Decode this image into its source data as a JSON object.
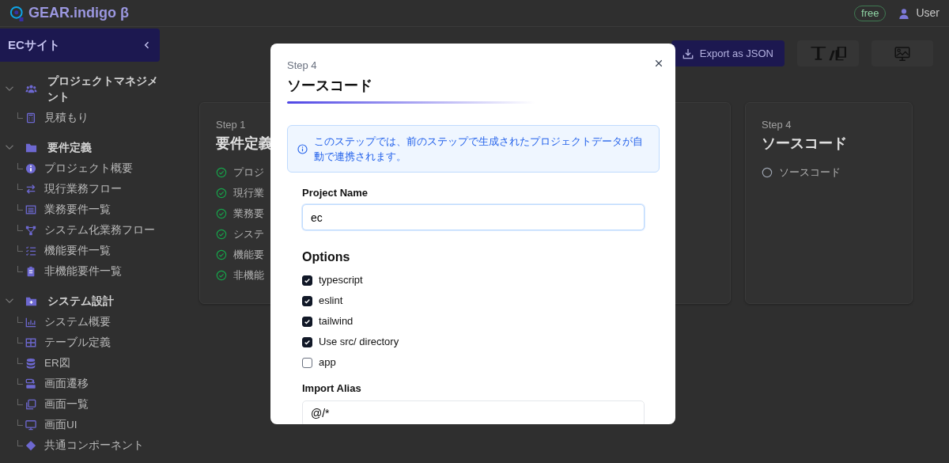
{
  "app_header": {
    "logo": "GEAR.indigo β",
    "plan_badge": "free",
    "user": "User"
  },
  "sidebar": {
    "project": "ECサイト",
    "groups": [
      {
        "label": "プロジェクトマネジメント",
        "expanded": true,
        "items": [
          {
            "label": "見積もり"
          }
        ]
      },
      {
        "label": "要件定義",
        "expanded": true,
        "items": [
          {
            "label": "プロジェクト概要"
          },
          {
            "label": "現行業務フロー"
          },
          {
            "label": "業務要件一覧"
          },
          {
            "label": "システム化業務フロー"
          },
          {
            "label": "機能要件一覧"
          },
          {
            "label": "非機能要件一覧"
          }
        ]
      },
      {
        "label": "システム設計",
        "expanded": true,
        "items": [
          {
            "label": "システム概要"
          },
          {
            "label": "テーブル定義"
          },
          {
            "label": "ER図"
          },
          {
            "label": "画面遷移"
          },
          {
            "label": "画面一覧"
          },
          {
            "label": "画面UI"
          },
          {
            "label": "共通コンポーネント"
          }
        ]
      }
    ]
  },
  "toolbar": {
    "export_button": "Export as JSON"
  },
  "step_cards": [
    {
      "step": "Step 1",
      "title": "要件定義",
      "items": [
        {
          "label": "プロジ",
          "done": true
        },
        {
          "label": "現行業",
          "done": true
        },
        {
          "label": "業務要",
          "done": true
        },
        {
          "label": "システ",
          "done": true
        },
        {
          "label": "機能要",
          "done": true
        },
        {
          "label": "非機能",
          "done": true
        }
      ]
    },
    {
      "step": "Step 4",
      "title": "ソースコード",
      "items": [
        {
          "label": "ソースコード",
          "done": false
        }
      ]
    }
  ],
  "dialog": {
    "step": "Step 4",
    "title": "ソースコード",
    "info": "このステップでは、前のステップで生成されたプロジェクトデータが自動で連携されます。",
    "project_name": {
      "label": "Project Name",
      "value": "ec"
    },
    "options": {
      "title": "Options",
      "items": [
        {
          "label": "typescript",
          "checked": true
        },
        {
          "label": "eslint",
          "checked": true
        },
        {
          "label": "tailwind",
          "checked": true
        },
        {
          "label": "Use src/ directory",
          "checked": true
        },
        {
          "label": "app",
          "checked": false
        }
      ]
    },
    "import_alias": {
      "label": "Import Alias",
      "value": "@/*"
    }
  }
}
